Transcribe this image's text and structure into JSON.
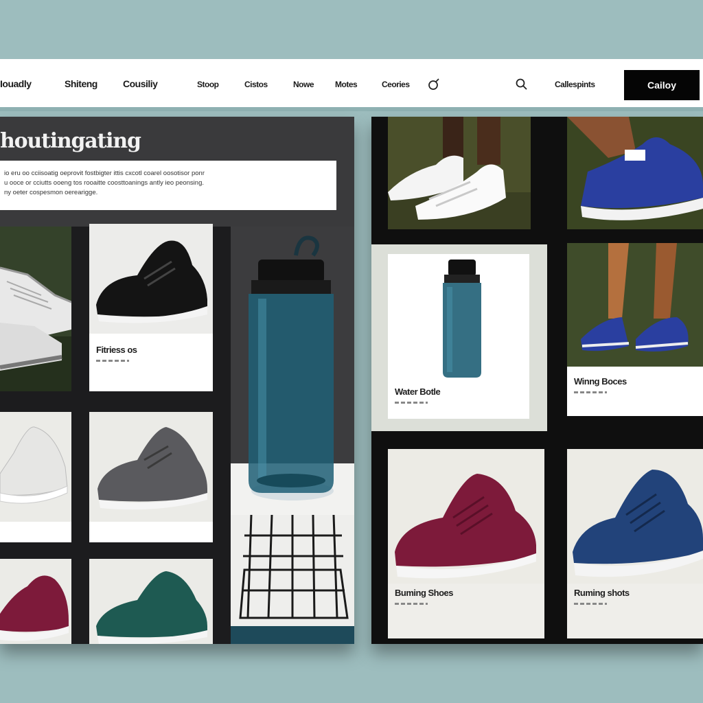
{
  "nav": {
    "items": [
      "Iouadly",
      "Shiteng",
      "Cousiliy",
      "Stoop",
      "Cistos",
      "Nowe",
      "Motes",
      "Ceories"
    ],
    "account_label": "Callespints",
    "cta_label": "Cailoy"
  },
  "hero": {
    "title": "houtingating",
    "description_lines": [
      "io eru oo cciisoatig  oeprovit fostbigter ittis cxcotl coarel oosotisor ponr",
      "u ooce or cciutts ooeng tos rooaitte coosttoanings antly ieo peonsing.",
      "ny oeter cospesmon oerearigge."
    ]
  },
  "products": {
    "fitness": {
      "label": "Fitriess os"
    },
    "water_bottle": {
      "label": "Water Botle"
    },
    "winning_shoes": {
      "label": "Winng Boces"
    },
    "running_shoes_1": {
      "label": "Buming Shoes"
    },
    "running_shoes_2": {
      "label": "Ruming shots"
    }
  },
  "colors": {
    "background": "#9dbdbe",
    "nav_cta": "#050505",
    "bottle": "#1f5f75",
    "shoe_maroon": "#7d1a3a",
    "shoe_navy": "#22437a",
    "shoe_teal": "#1e5a52",
    "shoe_royal": "#2a3fa0"
  }
}
